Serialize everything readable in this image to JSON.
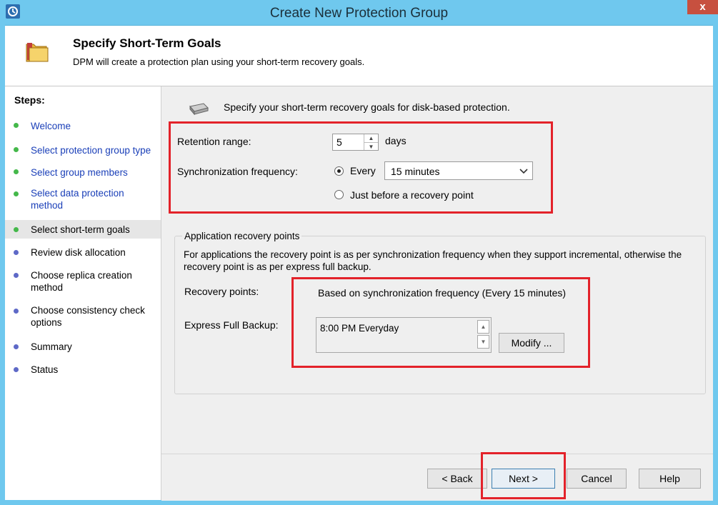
{
  "window": {
    "title": "Create New Protection Group",
    "close_label": "x"
  },
  "header": {
    "title": "Specify Short-Term Goals",
    "subtitle": "DPM will create a protection plan using your short-term recovery goals."
  },
  "steps": {
    "title": "Steps:",
    "items": [
      {
        "label": "Welcome",
        "state": "done"
      },
      {
        "label": "Select protection group type",
        "state": "done"
      },
      {
        "label": "Select group members",
        "state": "done"
      },
      {
        "label": "Select data protection method",
        "state": "done"
      },
      {
        "label": "Select short-term goals",
        "state": "current"
      },
      {
        "label": "Review disk allocation",
        "state": "pending"
      },
      {
        "label": "Choose replica creation method",
        "state": "pending"
      },
      {
        "label": "Choose consistency check options",
        "state": "pending"
      },
      {
        "label": "Summary",
        "state": "pending"
      },
      {
        "label": "Status",
        "state": "pending"
      }
    ]
  },
  "main": {
    "intro": "Specify your short-term recovery goals for disk-based protection.",
    "retention": {
      "label": "Retention range:",
      "value": "5",
      "unit": "days"
    },
    "sync": {
      "label": "Synchronization frequency:",
      "every_label": "Every",
      "every_selected": true,
      "frequency_value": "15 minutes",
      "before_label": "Just before a recovery point",
      "before_selected": false
    },
    "app_group": {
      "title": "Application recovery points",
      "description": "For applications the recovery point is as per synchronization frequency when they support incremental, otherwise the recovery point is as per express full backup.",
      "recovery_points_label": "Recovery points:",
      "recovery_points_value": "Based on synchronization frequency (Every 15 minutes)",
      "express_label": "Express Full Backup:",
      "express_value": "8:00 PM Everyday",
      "modify_label": "Modify ..."
    }
  },
  "footer": {
    "back_label": "< Back",
    "next_label": "Next >",
    "cancel_label": "Cancel",
    "help_label": "Help"
  },
  "colors": {
    "titlebar": "#6fc8ee",
    "highlight_box": "#e3222a",
    "step_done": "#44b84a",
    "step_pending": "#5e69c7",
    "link": "#1a3fb8"
  }
}
